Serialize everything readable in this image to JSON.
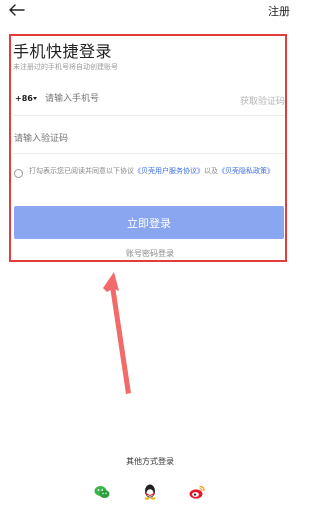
{
  "header": {
    "register_label": "注册"
  },
  "login": {
    "title": "手机快捷登录",
    "subtitle": "未注册过的手机号将自动创建账号",
    "country_code": "+86",
    "phone_placeholder": "请输入手机号",
    "get_code_label": "获取验证码",
    "code_placeholder": "请输入验证码",
    "agreement_prefix": "打勾表示您已阅读并同意以下协议",
    "agreement_link1": "《贝壳用户服务协议》",
    "agreement_middle": "以及",
    "agreement_link2": "《贝壳隐私政策》",
    "login_button": "立即登录",
    "password_login": "账号密码登录"
  },
  "other_methods": {
    "label": "其他方式登录",
    "icons": [
      "wechat-icon",
      "qq-icon",
      "weibo-icon"
    ]
  },
  "colors": {
    "primary_button": "#8aa6f0",
    "link": "#3d6fe0",
    "annotation": "#e23c3c"
  }
}
